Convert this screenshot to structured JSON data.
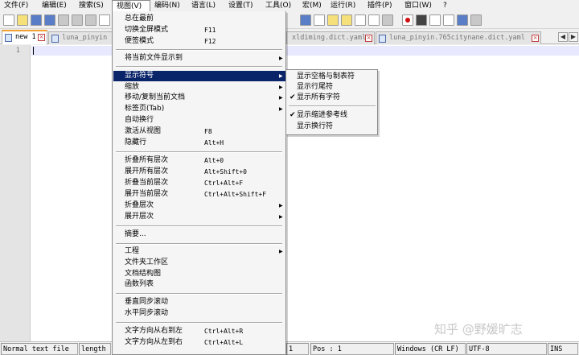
{
  "menubar": {
    "items": [
      "文件(F)",
      "编辑(E)",
      "搜索(S)",
      "视图(V)",
      "编码(N)",
      "语言(L)",
      "设置(T)",
      "工具(O)",
      "宏(M)",
      "运行(R)",
      "插件(P)",
      "窗口(W)",
      "?"
    ]
  },
  "tabs": [
    {
      "label": "new 1"
    },
    {
      "label": "luna_pinyin"
    },
    {
      "label": "xldiming.dict.yaml"
    },
    {
      "label": "luna_pinyin.765citynane.dict.yaml"
    }
  ],
  "editor": {
    "line_number": "1"
  },
  "view_menu": {
    "items": [
      {
        "label": "总在最前",
        "shortcut": ""
      },
      {
        "label": "切换全屏模式",
        "shortcut": "F11"
      },
      {
        "label": "便签模式",
        "shortcut": "F12"
      },
      {
        "label": "将当前文件显示到",
        "shortcut": "",
        "submenu": true
      },
      {
        "label": "显示符号",
        "shortcut": "",
        "submenu": true,
        "highlighted": true
      },
      {
        "label": "缩放",
        "shortcut": "",
        "submenu": true
      },
      {
        "label": "移动/复制当前文档",
        "shortcut": "",
        "submenu": true
      },
      {
        "label": "标签页(Tab)",
        "shortcut": "",
        "submenu": true
      },
      {
        "label": "自动换行",
        "shortcut": ""
      },
      {
        "label": "激活从视图",
        "shortcut": "F8"
      },
      {
        "label": "隐藏行",
        "shortcut": "Alt+H"
      },
      {
        "label": "折叠所有层次",
        "shortcut": "Alt+0"
      },
      {
        "label": "展开所有层次",
        "shortcut": "Alt+Shift+0"
      },
      {
        "label": "折叠当前层次",
        "shortcut": "Ctrl+Alt+F"
      },
      {
        "label": "展开当前层次",
        "shortcut": "Ctrl+Alt+Shift+F"
      },
      {
        "label": "折叠层次",
        "shortcut": "",
        "submenu": true
      },
      {
        "label": "展开层次",
        "shortcut": "",
        "submenu": true
      },
      {
        "label": "摘要...",
        "shortcut": ""
      },
      {
        "label": "工程",
        "shortcut": "",
        "submenu": true
      },
      {
        "label": "文件夹工作区",
        "shortcut": ""
      },
      {
        "label": "文档结构图",
        "shortcut": ""
      },
      {
        "label": "函数列表",
        "shortcut": ""
      },
      {
        "label": "垂直同步滚动",
        "shortcut": ""
      },
      {
        "label": "水平同步滚动",
        "shortcut": ""
      },
      {
        "label": "文字方向从右到左",
        "shortcut": "Ctrl+Alt+R"
      },
      {
        "label": "文字方向从左到右",
        "shortcut": "Ctrl+Alt+L"
      }
    ]
  },
  "symbols_submenu": {
    "items": [
      {
        "label": "显示空格与制表符",
        "checked": false
      },
      {
        "label": "显示行尾符",
        "checked": false
      },
      {
        "label": "显示所有字符",
        "checked": true
      },
      {
        "label": "显示缩进参考线",
        "checked": true
      },
      {
        "label": "显示换行符",
        "checked": false
      }
    ]
  },
  "statusbar": {
    "file_type": "Normal text file",
    "length": "length :",
    "line_col": "1",
    "pos": "Pos : 1",
    "eol": "Windows (CR LF)",
    "encoding": "UTF-8",
    "mode": "INS"
  },
  "watermark": "知乎 @野媛旷志"
}
